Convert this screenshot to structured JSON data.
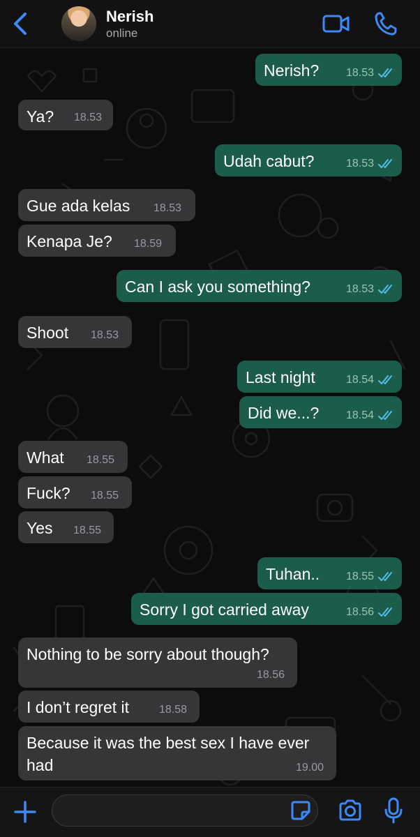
{
  "header": {
    "contact_name": "Nerish",
    "status": "online",
    "icons": {
      "back": "chevron-left-icon",
      "video": "video-camera-icon",
      "call": "phone-icon"
    }
  },
  "colors": {
    "accent": "#3d8af7",
    "incoming_bubble": "#363638",
    "outgoing_bubble": "#1c5c4a",
    "read_ticks": "#53bdeb",
    "background": "#0c0c0c"
  },
  "messages": [
    {
      "dir": "out",
      "text": "Nerish?",
      "time": "18.53",
      "read": true
    },
    {
      "dir": "in",
      "text": "Ya?",
      "time": "18.53"
    },
    {
      "dir": "out",
      "text": "Udah cabut?",
      "time": "18.53",
      "read": true
    },
    {
      "dir": "in",
      "text": "Gue ada kelas",
      "time": "18.53"
    },
    {
      "dir": "in",
      "text": "Kenapa Je?",
      "time": "18.59"
    },
    {
      "dir": "out",
      "text": "Can I ask you something?",
      "time": "18.53",
      "read": true
    },
    {
      "dir": "in",
      "text": "Shoot",
      "time": "18.53"
    },
    {
      "dir": "out",
      "text": "Last night",
      "time": "18.54",
      "read": true
    },
    {
      "dir": "out",
      "text": "Did we...?",
      "time": "18.54",
      "read": true
    },
    {
      "dir": "in",
      "text": "What",
      "time": "18.55"
    },
    {
      "dir": "in",
      "text": "Fuck?",
      "time": "18.55"
    },
    {
      "dir": "in",
      "text": "Yes",
      "time": "18.55"
    },
    {
      "dir": "out",
      "text": "Tuhan..",
      "time": "18.55",
      "read": true
    },
    {
      "dir": "out",
      "text": "Sorry I got carried away",
      "time": "18.56",
      "read": true
    },
    {
      "dir": "in",
      "text": "Nothing to be sorry about though?",
      "time": "18.56"
    },
    {
      "dir": "in",
      "text": "I don’t regret it",
      "time": "18.58"
    },
    {
      "dir": "in",
      "text": "Because it was the best sex I have ever\nhad",
      "time": "19.00"
    }
  ],
  "footer": {
    "input_value": "",
    "icons": {
      "add": "plus-icon",
      "sticker": "sticker-icon",
      "camera": "camera-icon",
      "mic": "microphone-icon"
    }
  }
}
